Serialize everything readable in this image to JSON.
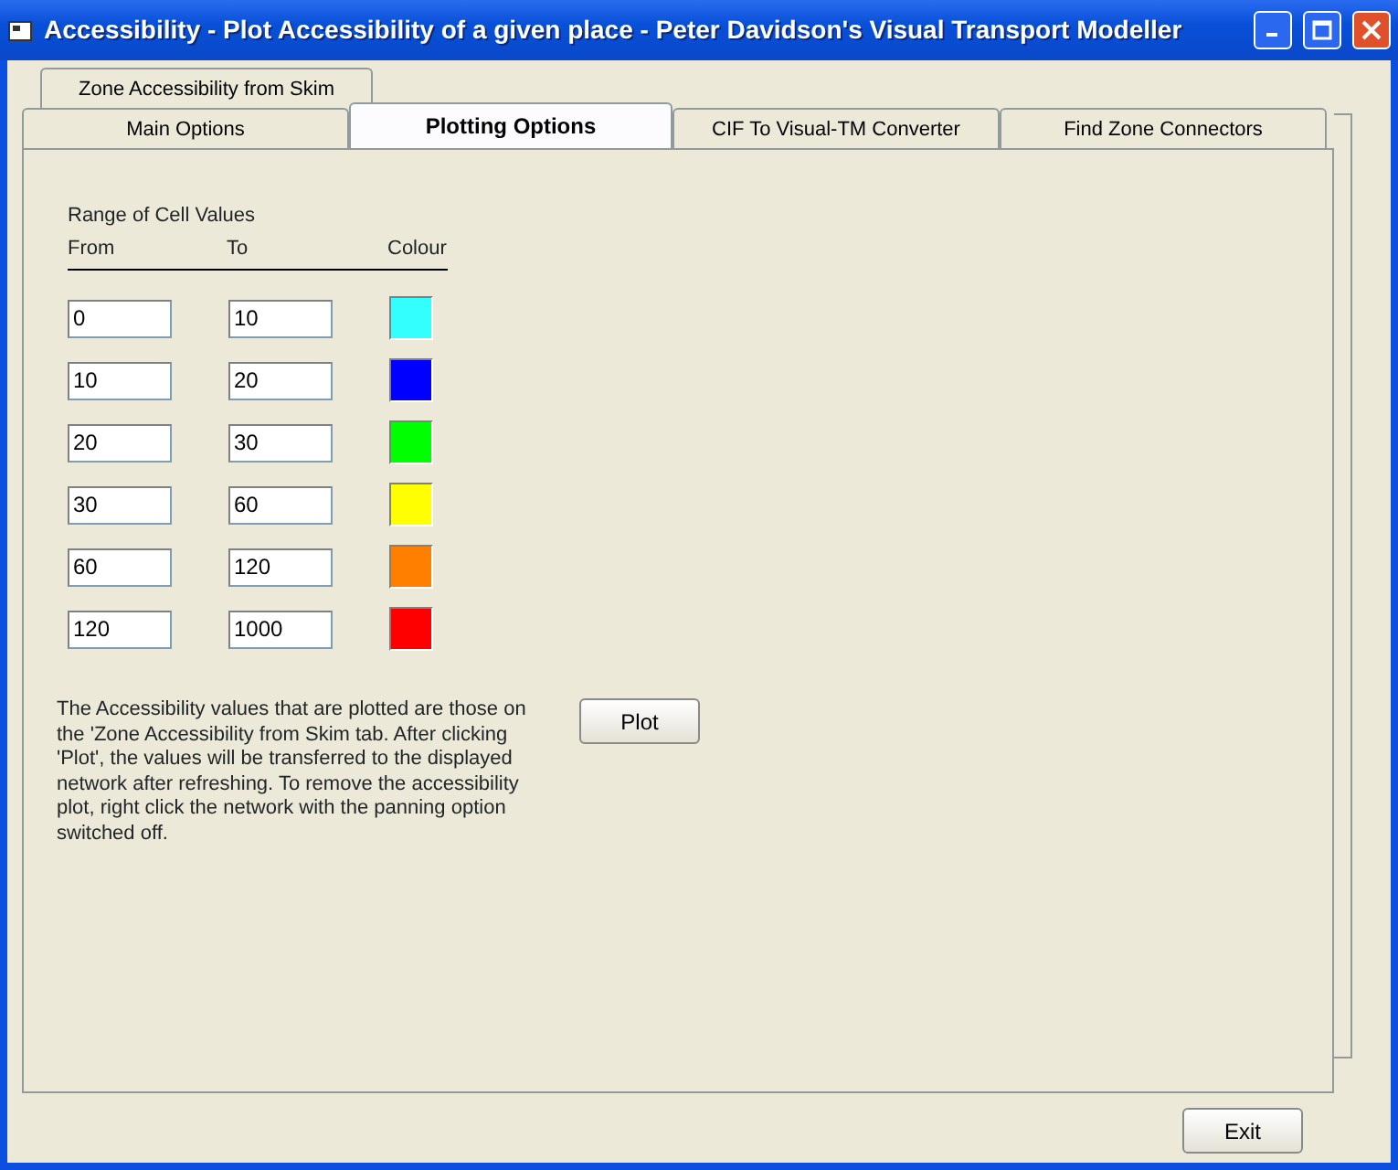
{
  "window": {
    "title": "Accessibility - Plot Accessibility of a given place - Peter Davidson's Visual Transport Modeller"
  },
  "tab_rows": [
    [
      {
        "label": "Zone Accessibility from Skim",
        "selected": false
      }
    ],
    [
      {
        "label": "Main Options",
        "selected": false
      },
      {
        "label": "Plotting Options",
        "selected": true
      },
      {
        "label": "CIF To Visual-TM Converter",
        "selected": false
      },
      {
        "label": "Find Zone Connectors",
        "selected": false
      }
    ]
  ],
  "range": {
    "title": "Range of Cell Values",
    "columns": [
      "From",
      "To",
      "Colour"
    ],
    "rows": [
      {
        "from": "0",
        "to": "10",
        "color": "#33ffff"
      },
      {
        "from": "10",
        "to": "20",
        "color": "#0000ff"
      },
      {
        "from": "20",
        "to": "30",
        "color": "#00ff00"
      },
      {
        "from": "30",
        "to": "60",
        "color": "#ffff00"
      },
      {
        "from": "60",
        "to": "120",
        "color": "#ff8000"
      },
      {
        "from": "120",
        "to": "1000",
        "color": "#ff0000"
      }
    ]
  },
  "note": "The Accessibility values that are plotted are those on the 'Zone Accessibility from Skim tab.  After clicking 'Plot', the values will be transferred to the displayed network after refreshing. To remove the accessibility plot, right click the network with the panning option switched off.",
  "plot_button": "Plot",
  "exit_button": "Exit"
}
